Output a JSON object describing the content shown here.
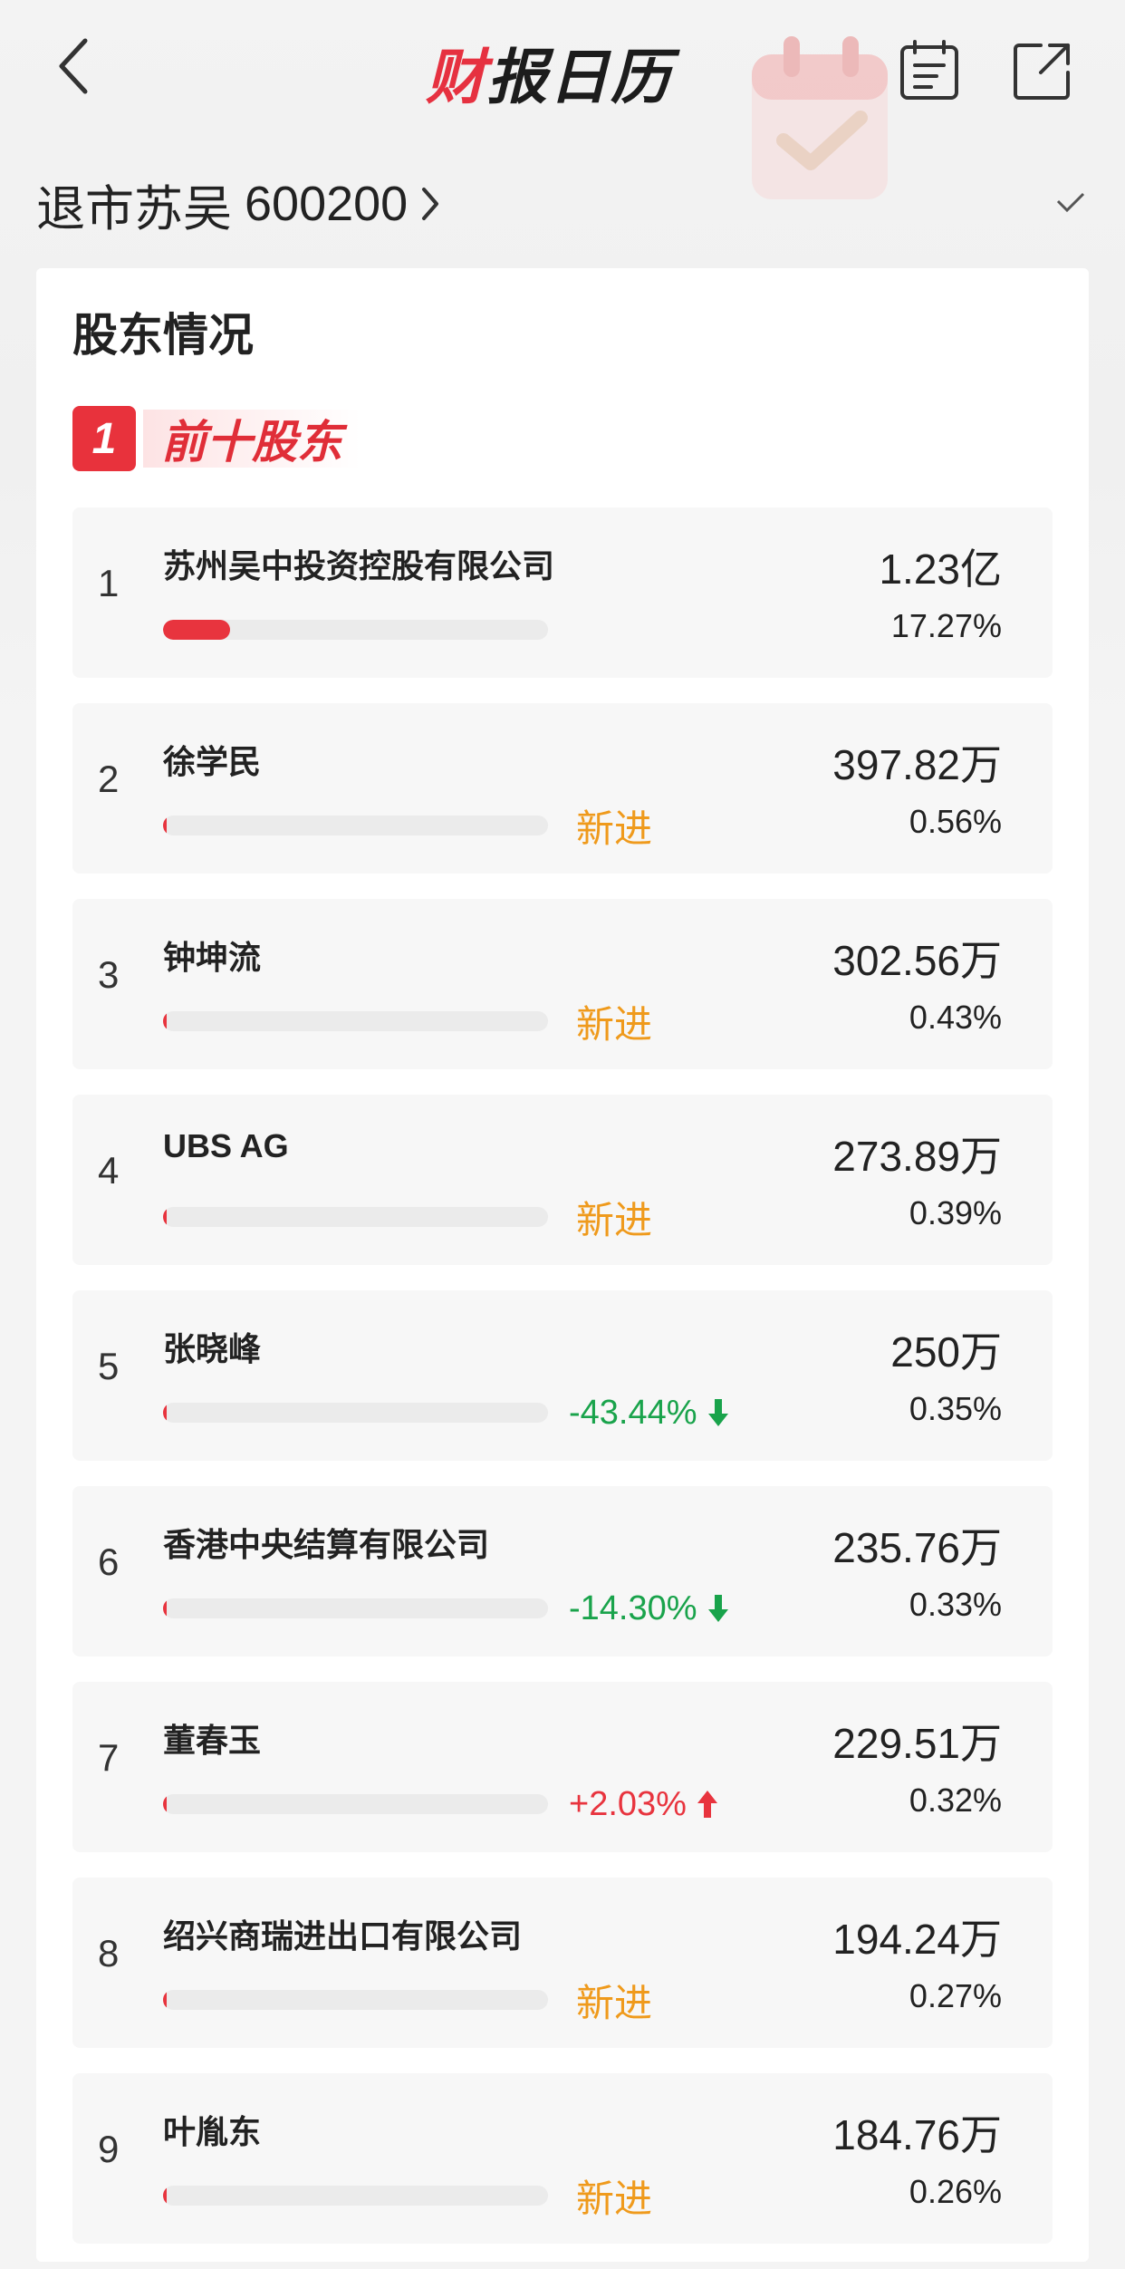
{
  "header": {
    "back_icon": "chevron-left-icon",
    "logo_text_1": "财",
    "logo_text_2": "报日历",
    "calendar_icon": "calendar-list-icon",
    "share_icon": "share-external-icon"
  },
  "stock": {
    "name": "退市苏吴",
    "code": "600200",
    "arrow_icon": "chevron-right-icon"
  },
  "section": {
    "title": "股东情况",
    "sub_number": "1",
    "sub_label": "前十股东"
  },
  "colors": {
    "accent_red": "#e8343e",
    "new_orange": "#ef9a1c",
    "down_green": "#19a34b"
  },
  "shareholders": [
    {
      "rank": "1",
      "name": "苏州吴中投资控股有限公司",
      "amount": "1.23亿",
      "pct": "17.27%",
      "bar_pct": 17.27,
      "change_type": "none",
      "change": ""
    },
    {
      "rank": "2",
      "name": "徐学民",
      "amount": "397.82万",
      "pct": "0.56%",
      "bar_pct": 0.56,
      "change_type": "new",
      "change": "新进"
    },
    {
      "rank": "3",
      "name": "钟坤流",
      "amount": "302.56万",
      "pct": "0.43%",
      "bar_pct": 0.43,
      "change_type": "new",
      "change": "新进"
    },
    {
      "rank": "4",
      "name": "UBS AG",
      "amount": "273.89万",
      "pct": "0.39%",
      "bar_pct": 0.39,
      "change_type": "new",
      "change": "新进"
    },
    {
      "rank": "5",
      "name": "张晓峰",
      "amount": "250万",
      "pct": "0.35%",
      "bar_pct": 0.35,
      "change_type": "down",
      "change": "-43.44%"
    },
    {
      "rank": "6",
      "name": "香港中央结算有限公司",
      "amount": "235.76万",
      "pct": "0.33%",
      "bar_pct": 0.33,
      "change_type": "down",
      "change": "-14.30%"
    },
    {
      "rank": "7",
      "name": "董春玉",
      "amount": "229.51万",
      "pct": "0.32%",
      "bar_pct": 0.32,
      "change_type": "up",
      "change": "+2.03%"
    },
    {
      "rank": "8",
      "name": "绍兴商瑞进出口有限公司",
      "amount": "194.24万",
      "pct": "0.27%",
      "bar_pct": 0.27,
      "change_type": "new",
      "change": "新进"
    },
    {
      "rank": "9",
      "name": "叶胤东",
      "amount": "184.76万",
      "pct": "0.26%",
      "bar_pct": 0.26,
      "change_type": "new",
      "change": "新进"
    }
  ]
}
